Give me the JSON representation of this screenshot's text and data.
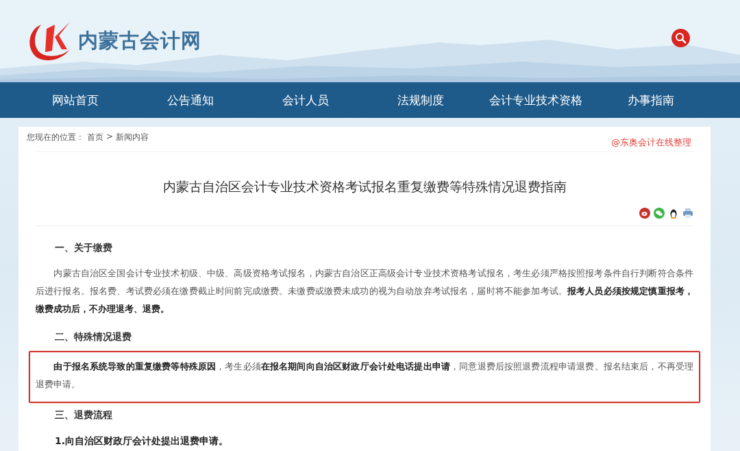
{
  "site": {
    "name": "内蒙古会计网"
  },
  "nav": [
    {
      "label": "网站首页"
    },
    {
      "label": "公告通知"
    },
    {
      "label": "会计人员"
    },
    {
      "label": "法规制度"
    },
    {
      "label": "会计专业技术资格"
    },
    {
      "label": "办事指南"
    }
  ],
  "breadcrumb": {
    "label": "您现在的位置：",
    "items": [
      "首页",
      "新闻内容"
    ],
    "separator": ">"
  },
  "credit": "@东奥会计在线整理",
  "article": {
    "title": "内蒙古自治区会计专业技术资格考试报名重复缴费等特殊情况退费指南",
    "share": [
      {
        "kind": "swirl"
      },
      {
        "kind": "chat"
      },
      {
        "kind": "penguin"
      },
      {
        "kind": "print"
      }
    ],
    "blocks": [
      {
        "kind": "heading",
        "text": "一、关于缴费"
      },
      {
        "kind": "paragraph",
        "text": "内蒙古自治区全国会计专业技术初级、中级、高级资格考试报名，内蒙古自治区正高级会计专业技术资格考试报名，考生必须严格按照报考条件自行判断符合条件后进行报名。报名费、考试费必须在缴费截止时间前完成缴费。未缴费或缴费未成功的视为自动放弃考试报名，届时将不能参加考试。**报考人员必须按规定慎重报考，缴费成功后，不办理退考、退费。**",
        "highlighted": false
      },
      {
        "kind": "heading",
        "text": "二、特殊情况退费"
      },
      {
        "kind": "paragraph",
        "text": "**由于报名系统导致的重复缴费等特殊原因**，考生必须**在报名期间向自治区财政厅会计处电话提出申请**，同意退费后按照退费流程申请退费。报名结束后，不再受理退费申请。",
        "highlighted": true
      },
      {
        "kind": "heading",
        "text": "三、退费流程"
      },
      {
        "kind": "step",
        "text": "1.向自治区财政厅会计处提出退费申请。"
      }
    ]
  }
}
